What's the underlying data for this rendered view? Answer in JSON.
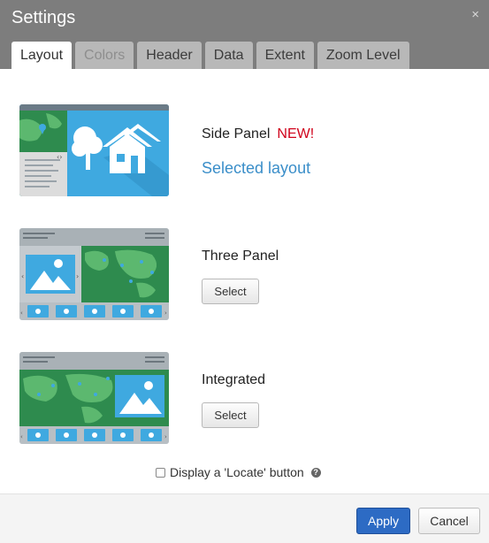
{
  "dialog": {
    "title": "Settings",
    "close_glyph": "×"
  },
  "tabs": [
    {
      "label": "Layout",
      "state": "active"
    },
    {
      "label": "Colors",
      "state": "disabled"
    },
    {
      "label": "Header",
      "state": "normal"
    },
    {
      "label": "Data",
      "state": "normal"
    },
    {
      "label": "Extent",
      "state": "normal"
    },
    {
      "label": "Zoom Level",
      "state": "normal"
    }
  ],
  "layouts": [
    {
      "name": "Side Panel",
      "badge": "NEW!",
      "status": "Selected layout",
      "thumbnail_icon": "side-panel-layout-icon"
    },
    {
      "name": "Three Panel",
      "button_label": "Select",
      "thumbnail_icon": "three-panel-layout-icon"
    },
    {
      "name": "Integrated",
      "button_label": "Select",
      "thumbnail_icon": "integrated-layout-icon"
    }
  ],
  "locate_option": {
    "label": "Display a 'Locate' button",
    "checked": false,
    "help_icon": "question-circle-icon"
  },
  "footer": {
    "apply_label": "Apply",
    "cancel_label": "Cancel"
  },
  "colors": {
    "header_bg": "#7d7d7d",
    "accent_blue": "#3a8ec9",
    "new_badge_red": "#d0021b",
    "apply_blue": "#2d6bc4",
    "map_green": "#2e8b4e"
  }
}
